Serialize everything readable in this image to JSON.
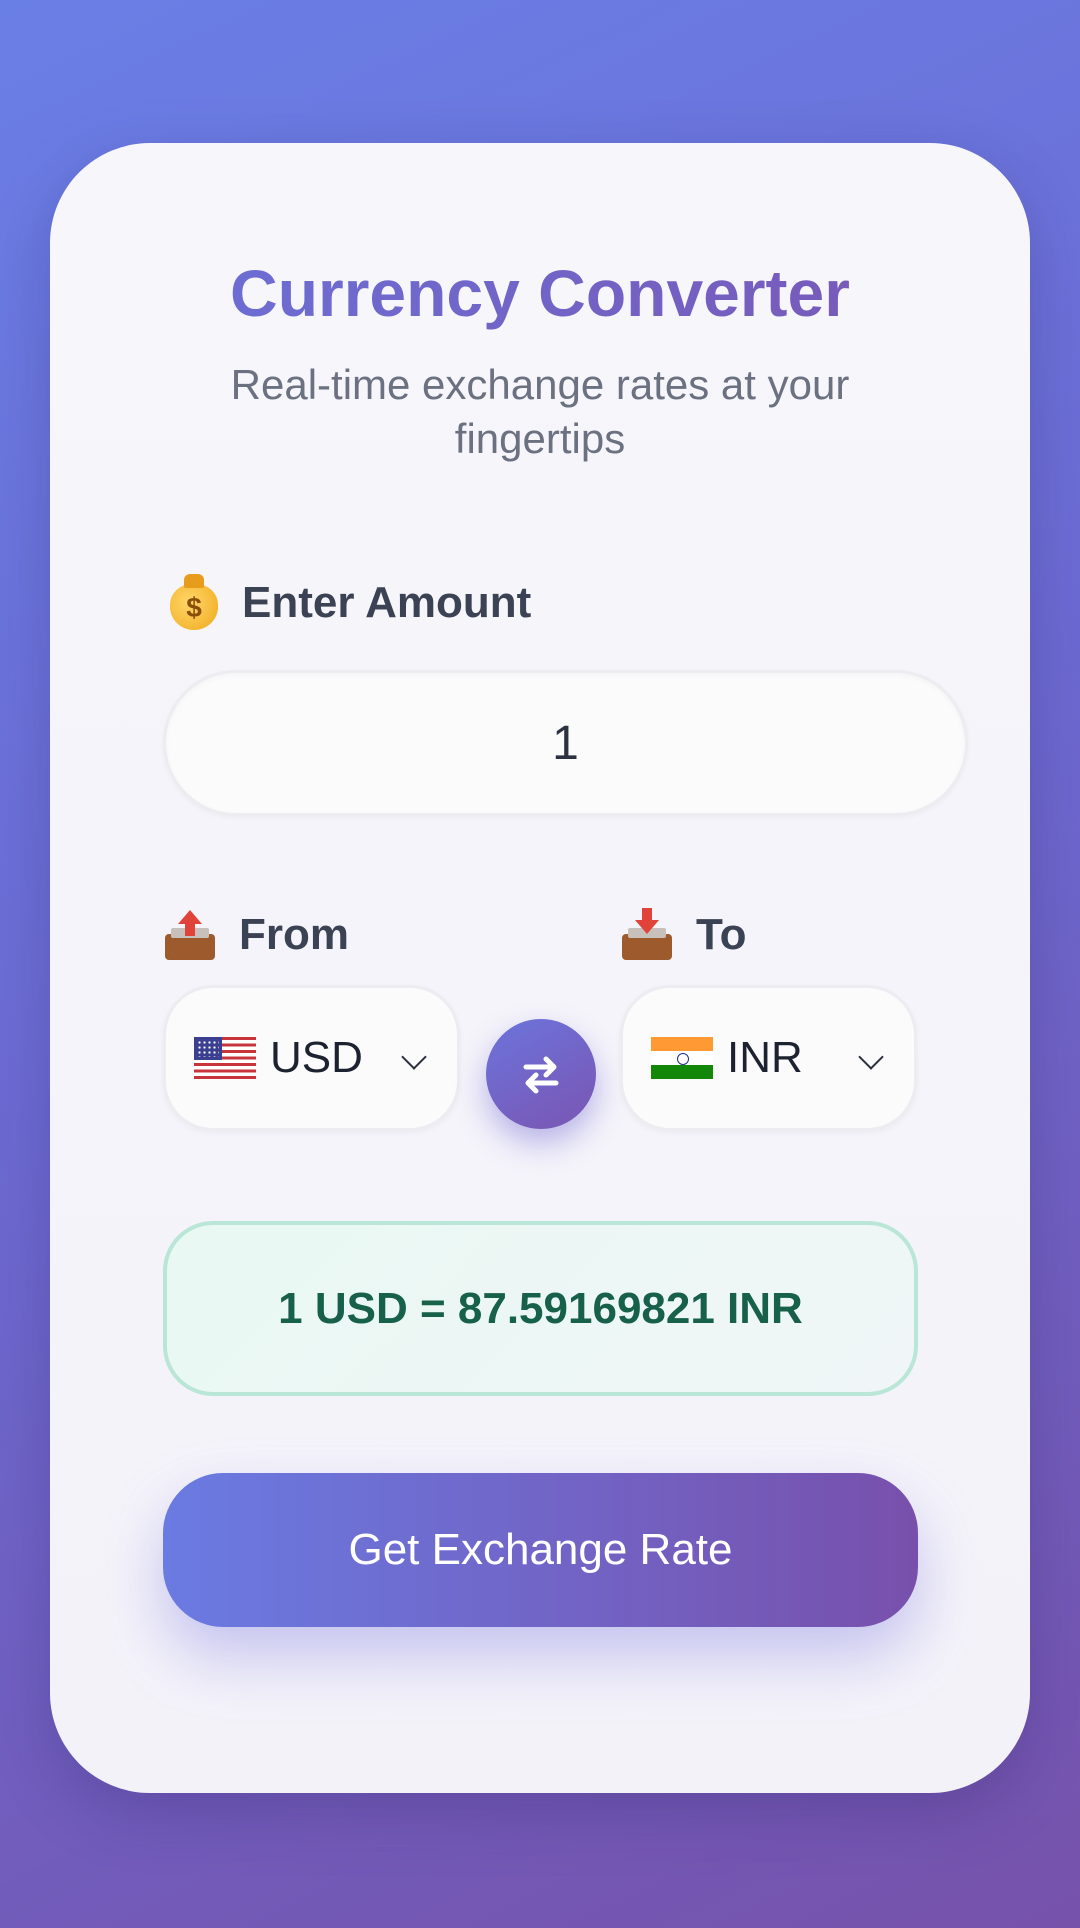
{
  "header": {
    "title": "Currency Converter",
    "subtitle": "Real-time exchange rates at your fingertips"
  },
  "amount": {
    "label": "Enter Amount",
    "value": "1",
    "icon": "money-bag-icon"
  },
  "from": {
    "label": "From",
    "icon": "outbox-tray-icon",
    "currency": "USD",
    "flag": "us-flag-icon"
  },
  "to": {
    "label": "To",
    "icon": "inbox-tray-icon",
    "currency": "INR",
    "flag": "india-flag-icon"
  },
  "swap": {
    "icon": "swap-arrows-icon"
  },
  "result": {
    "text": "1 USD = 87.59169821 INR"
  },
  "actions": {
    "get_rate_label": "Get Exchange Rate"
  },
  "colors": {
    "accent": "#6a72d9",
    "accent_end": "#7a56b4",
    "result_text": "#17604a",
    "result_border": "#b9e6d6"
  }
}
